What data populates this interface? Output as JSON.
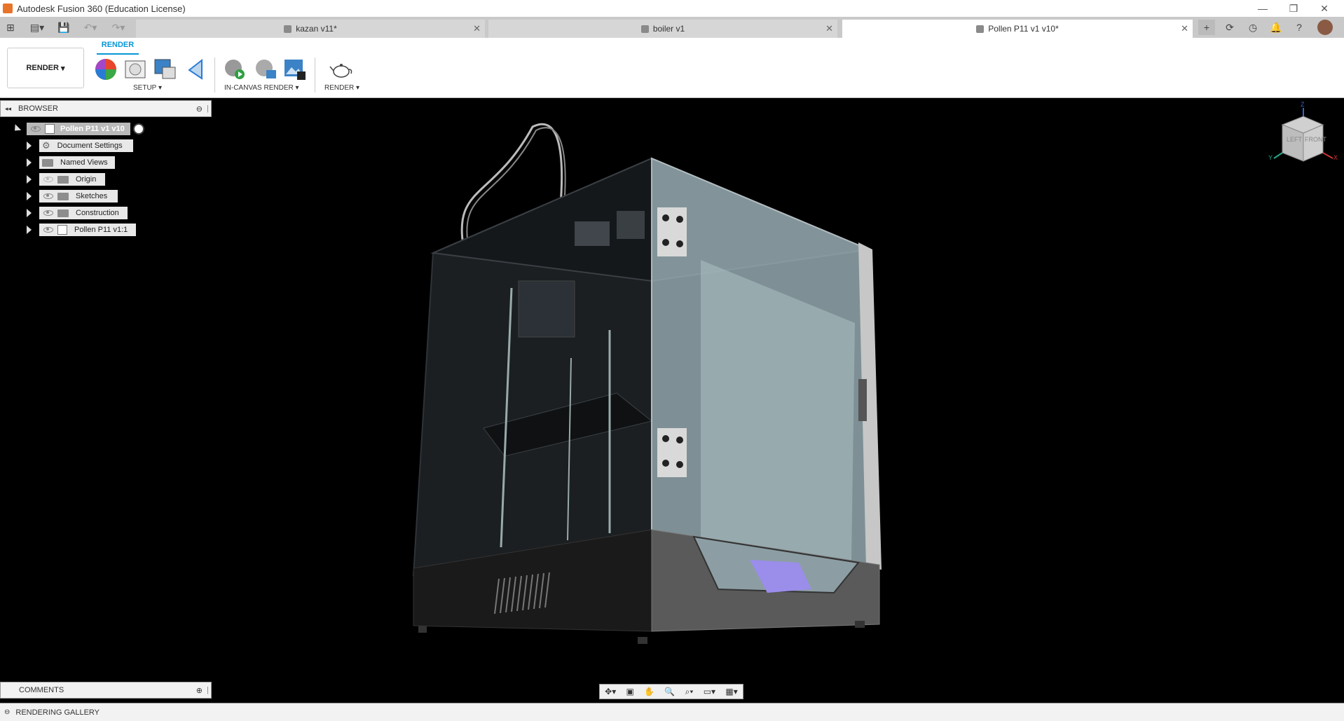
{
  "window": {
    "title": "Autodesk Fusion 360 (Education License)"
  },
  "tabs": [
    {
      "label": "kazan v11*",
      "active": false
    },
    {
      "label": "boiler v1",
      "active": false
    },
    {
      "label": "Pollen P11 v1 v10*",
      "active": true
    }
  ],
  "toolbar": {
    "workspace_label": "RENDER",
    "active_tab": "RENDER",
    "groups": {
      "setup": "SETUP",
      "in_canvas": "IN-CANVAS RENDER",
      "render": "RENDER"
    }
  },
  "browser": {
    "title": "BROWSER",
    "root": "Pollen P11 v1 v10",
    "items": [
      {
        "label": "Document Settings",
        "icon": "gear-icon",
        "eye": false
      },
      {
        "label": "Named Views",
        "icon": "folder-icon",
        "eye": false
      },
      {
        "label": "Origin",
        "icon": "folder-icon",
        "eye": true
      },
      {
        "label": "Sketches",
        "icon": "folder-icon",
        "eye": true
      },
      {
        "label": "Construction",
        "icon": "folder-icon",
        "eye": true
      },
      {
        "label": "Pollen P11 v1:1",
        "icon": "component-icon",
        "eye": true
      }
    ]
  },
  "viewcube": {
    "left": "LEFT",
    "front": "FRONT",
    "axes": {
      "z": "Z",
      "y": "Y",
      "x": "X"
    }
  },
  "comments": {
    "title": "COMMENTS"
  },
  "status": {
    "label": "RENDERING GALLERY"
  },
  "colors": {
    "accent": "#0696d7",
    "viewport_bg": "#000000"
  }
}
